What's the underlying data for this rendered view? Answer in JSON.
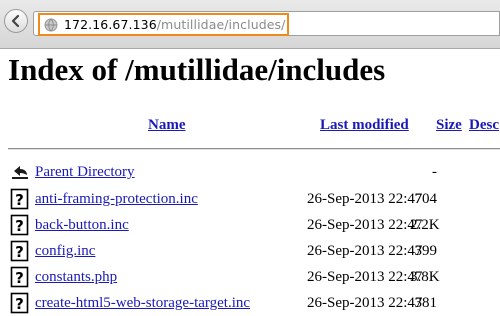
{
  "browser": {
    "url_host": "172.16.67.136",
    "url_path": "/mutillidae/includes/"
  },
  "page": {
    "title": "Index of /mutillidae/includes"
  },
  "table": {
    "columns": [
      "Name",
      "Last modified",
      "Size",
      "Desc"
    ],
    "parent": {
      "name": "Parent Directory",
      "size": "-"
    },
    "rows": [
      {
        "name": "anti-framing-protection.inc",
        "modified": "26-Sep-2013 22:47",
        "size": "704"
      },
      {
        "name": "back-button.inc",
        "modified": "26-Sep-2013 22:47",
        "size": "2.2K"
      },
      {
        "name": "config.inc",
        "modified": "26-Sep-2013 22:47",
        "size": "399"
      },
      {
        "name": "constants.php",
        "modified": "26-Sep-2013 22:47",
        "size": "3.8K"
      },
      {
        "name": "create-html5-web-storage-target.inc",
        "modified": "26-Sep-2013 22:47",
        "size": "381"
      }
    ]
  },
  "icons": {
    "back": "back-arrow-icon",
    "site": "globe-icon",
    "parent": "parent-directory-icon",
    "file": "unknown-file-icon"
  },
  "colors": {
    "link": "#1a1ab8",
    "url_highlight": "#f08a1c"
  }
}
